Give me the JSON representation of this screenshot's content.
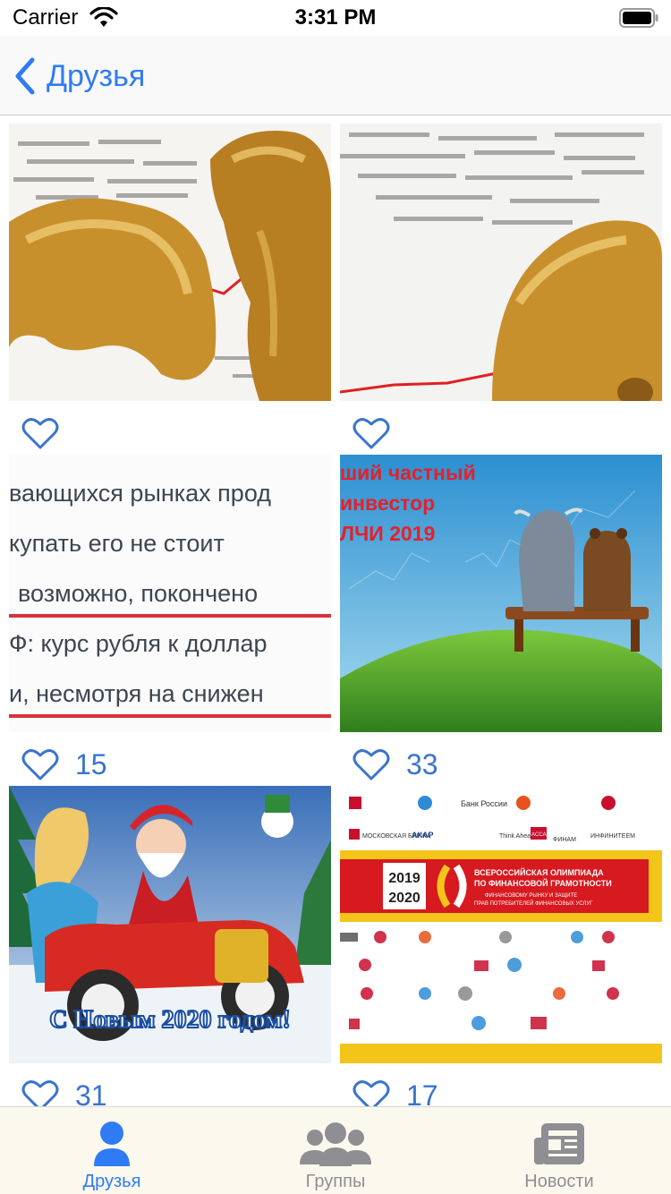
{
  "status_bar": {
    "carrier": "Carrier",
    "time": "3:31 PM"
  },
  "nav": {
    "back_label": "Друзья"
  },
  "photos": [
    {
      "likes": "",
      "caption_lines": []
    },
    {
      "likes": "",
      "caption_lines": []
    },
    {
      "likes": "15",
      "caption_lines": [
        "вающихся рынках прод",
        "купать его не стоит",
        "возможно, покончено",
        "Ф: курс рубля к доллар",
        "и, несмотря на снижен"
      ]
    },
    {
      "likes": "33",
      "caption_lines": [
        "ший частный",
        "инвестор",
        "ЛЧИ 2019"
      ]
    },
    {
      "likes": "31",
      "caption_lines": [
        "С Новым 2020 годом!"
      ]
    },
    {
      "likes": "17",
      "caption_lines": [
        "2019",
        "2020",
        "ВСЕРОССИЙСКАЯ ОЛИМПИАДА",
        "ПО ФИНАНСОВОЙ ГРАМОТНОСТИ",
        "ФИНАНСОВОМУ РЫНКУ И ЗАЩИТЕ",
        "ПРАВ ПОТРЕБИТЕЛЕЙ ФИНАНСОВЫХ УСЛУГ",
        "Банк России",
        "МОСКОВСКАЯ БИРЖА",
        "АКАР",
        "ФИНАМ",
        "Think Ahead",
        "ACCA",
        "ИНФИНИТЕЕМ"
      ]
    }
  ],
  "tabs": [
    {
      "label": "Друзья",
      "icon": "person-icon",
      "active": true
    },
    {
      "label": "Группы",
      "icon": "group-icon",
      "active": false
    },
    {
      "label": "Новости",
      "icon": "newspaper-icon",
      "active": false
    }
  ],
  "colors": {
    "accent": "#2f7bf5",
    "heart": "#3a74cc",
    "tab_inactive": "#8e8e93",
    "tab_bar_bg": "#fbf9ee"
  }
}
